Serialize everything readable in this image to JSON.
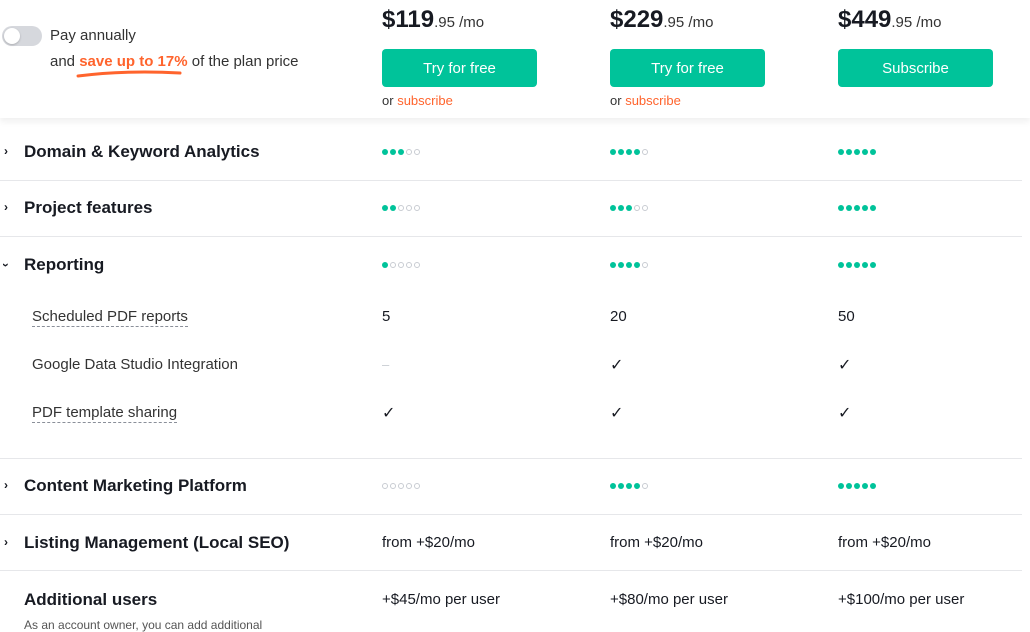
{
  "billing": {
    "toggle_label": "Pay annually",
    "save_prefix": "and",
    "save_highlight": "save up to 17%",
    "save_suffix": "of the plan price"
  },
  "plans": [
    {
      "dollars": "$119",
      "cents": ".95",
      "per": " /mo",
      "cta": "Try for free",
      "or_text": "or",
      "subscribe_link": "subscribe"
    },
    {
      "dollars": "$229",
      "cents": ".95",
      "per": " /mo",
      "cta": "Try for free",
      "or_text": "or",
      "subscribe_link": "subscribe"
    },
    {
      "dollars": "$449",
      "cents": ".95",
      "per": " /mo",
      "cta": "Subscribe"
    }
  ],
  "categories": {
    "domain": {
      "label": "Domain & Keyword Analytics",
      "ratings": [
        3,
        4,
        5
      ]
    },
    "project": {
      "label": "Project features",
      "ratings": [
        2,
        3,
        5
      ]
    },
    "reporting": {
      "label": "Reporting",
      "ratings": [
        1,
        4,
        5
      ],
      "subs": [
        {
          "label": "Scheduled PDF reports",
          "values": [
            "5",
            "20",
            "50"
          ]
        },
        {
          "label": "Google Data Studio Integration",
          "values": [
            "–",
            "✓",
            "✓"
          ]
        },
        {
          "label": "PDF template sharing",
          "values": [
            "✓",
            "✓",
            "✓"
          ]
        }
      ]
    },
    "content": {
      "label": "Content Marketing Platform",
      "ratings": [
        0,
        4,
        5
      ]
    },
    "listing": {
      "label": "Listing Management (Local SEO)",
      "values": [
        "from +$20/mo",
        "from +$20/mo",
        "from +$20/mo"
      ]
    },
    "users": {
      "label": "Additional users",
      "values": [
        "+$45/mo per user",
        "+$80/mo per user",
        "+$100/mo per user"
      ],
      "note": "As an account owner, you can add additional"
    }
  },
  "colors": {
    "accent": "#00c39a",
    "orange": "#ff642d",
    "text": "#171a22"
  },
  "icons": {
    "expand": "chevron-right-icon",
    "collapse": "chevron-down-icon",
    "check": "check-icon"
  }
}
